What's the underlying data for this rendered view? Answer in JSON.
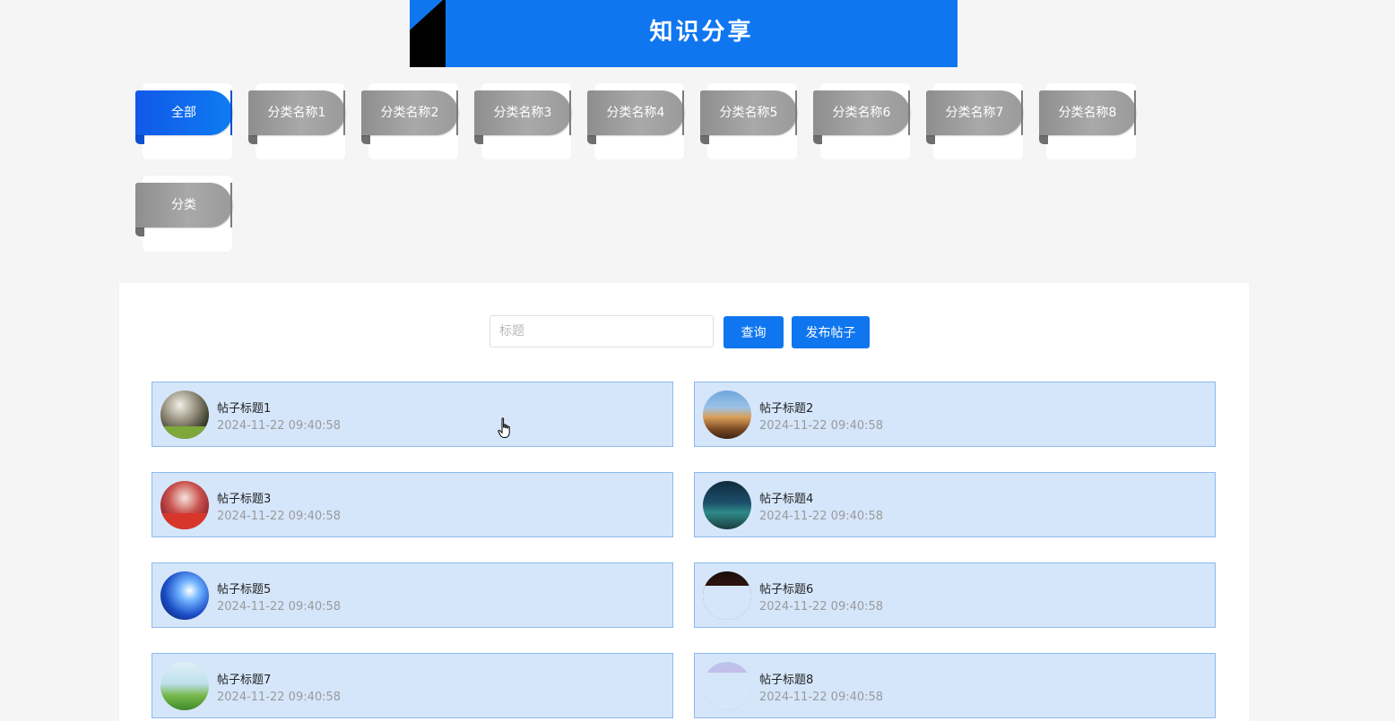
{
  "header": {
    "title": "知识分享",
    "color": "#0f76f0"
  },
  "categories": [
    {
      "label": "全部",
      "active": true
    },
    {
      "label": "分类名称1",
      "active": false
    },
    {
      "label": "分类名称2",
      "active": false
    },
    {
      "label": "分类名称3",
      "active": false
    },
    {
      "label": "分类名称4",
      "active": false
    },
    {
      "label": "分类名称5",
      "active": false
    },
    {
      "label": "分类名称6",
      "active": false
    },
    {
      "label": "分类名称7",
      "active": false
    },
    {
      "label": "分类名称8",
      "active": false
    },
    {
      "label": "分类",
      "active": false
    }
  ],
  "search": {
    "placeholder": "标题",
    "value": "",
    "query_label": "查询",
    "publish_label": "发布帖子"
  },
  "posts": [
    {
      "title": "帖子标题1",
      "date": "2024-11-22 09:40:58",
      "image": "soccer-photo"
    },
    {
      "title": "帖子标题2",
      "date": "2024-11-22 09:40:58",
      "image": "castle-photo"
    },
    {
      "title": "帖子标题3",
      "date": "2024-11-22 09:40:58",
      "image": "red-tree-photo"
    },
    {
      "title": "帖子标题4",
      "date": "2024-11-22 09:40:58",
      "image": "night-lake-photo"
    },
    {
      "title": "帖子标题5",
      "date": "2024-11-22 09:40:58",
      "image": "blue-sky-photo"
    },
    {
      "title": "帖子标题6",
      "date": "2024-11-22 09:40:58",
      "image": "red-field-photo"
    },
    {
      "title": "帖子标题7",
      "date": "2024-11-22 09:40:58",
      "image": "meadow-photo"
    },
    {
      "title": "帖子标题8",
      "date": "2024-11-22 09:40:58",
      "image": "purple-flower-photo"
    }
  ],
  "colors": {
    "accent": "#0f76f0",
    "card_bg": "#d5e6fb",
    "card_border": "#8cbaee",
    "tag_inactive": "#9e9e9e"
  }
}
